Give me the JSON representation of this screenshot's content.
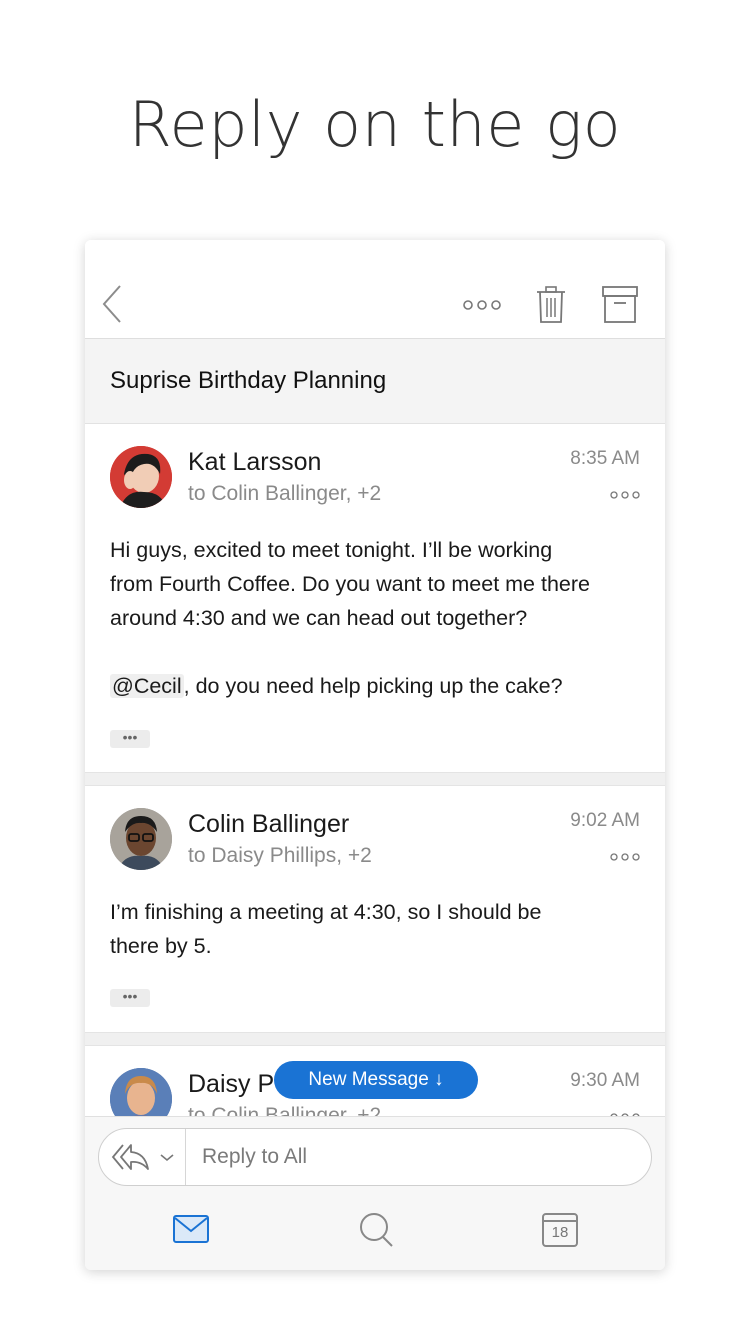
{
  "headline": "Reply on the go",
  "toolbar": {
    "back_icon": "chevron-left-icon",
    "more_icon": "more-horizontal-icon",
    "delete_icon": "trash-icon",
    "archive_icon": "archive-icon"
  },
  "subject": "Suprise Birthday Planning",
  "messages": [
    {
      "sender": "Kat Larsson",
      "recipients": "to Colin Ballinger, +2",
      "time": "8:35 AM",
      "body_lines": [
        "Hi guys, excited to meet tonight. I’ll be working",
        "from Fourth Coffee. Do you want to meet me there",
        "around 4:30 and we can head out together?"
      ],
      "mention": "@Cecil",
      "mention_rest": ", do you need help picking up the cake?",
      "expand": "•••"
    },
    {
      "sender": "Colin Ballinger",
      "recipients": "to Daisy Phillips, +2",
      "time": "9:02 AM",
      "body_lines": [
        "I’m finishing a meeting at 4:30, so I should be",
        "there by 5."
      ],
      "expand": "•••"
    },
    {
      "sender": "Daisy P",
      "recipients": "to Colin Ballinger, +2",
      "time": "9:30 AM"
    }
  ],
  "new_message_pill": "New Message ↓",
  "reply": {
    "placeholder": "Reply to All",
    "reply_all_icon": "reply-all-icon",
    "dropdown_icon": "chevron-down-icon"
  },
  "tabbar": {
    "mail_icon": "mail-icon",
    "search_icon": "search-icon",
    "calendar_icon": "calendar-icon",
    "calendar_day": "18",
    "active_color": "#1a73d4"
  }
}
